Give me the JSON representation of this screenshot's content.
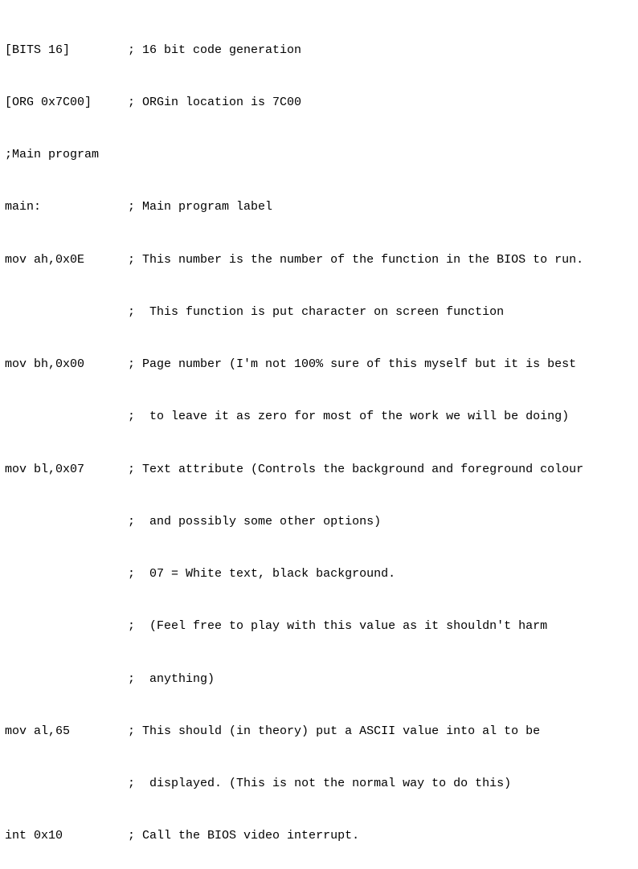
{
  "code": {
    "lines": [
      "[BITS 16]        ; 16 bit code generation",
      "[ORG 0x7C00]     ; ORGin location is 7C00",
      ";Main program",
      "main:            ; Main program label",
      "mov ah,0x0E      ; This number is the number of the function in the BIOS to run.",
      "                 ;  This function is put character on screen function",
      "mov bh,0x00      ; Page number (I'm not 100% sure of this myself but it is best",
      "                 ;  to leave it as zero for most of the work we will be doing)",
      "mov bl,0x07      ; Text attribute (Controls the background and foreground colour",
      "                 ;  and possibly some other options)",
      "                 ;  07 = White text, black background.",
      "                 ;  (Feel free to play with this value as it shouldn't harm",
      "                 ;  anything)",
      "mov al,65        ; This should (in theory) put a ASCII value into al to be",
      "                 ;  displayed. (This is not the normal way to do this)",
      "int 0x10         ; Call the BIOS video interrupt."
    ]
  }
}
